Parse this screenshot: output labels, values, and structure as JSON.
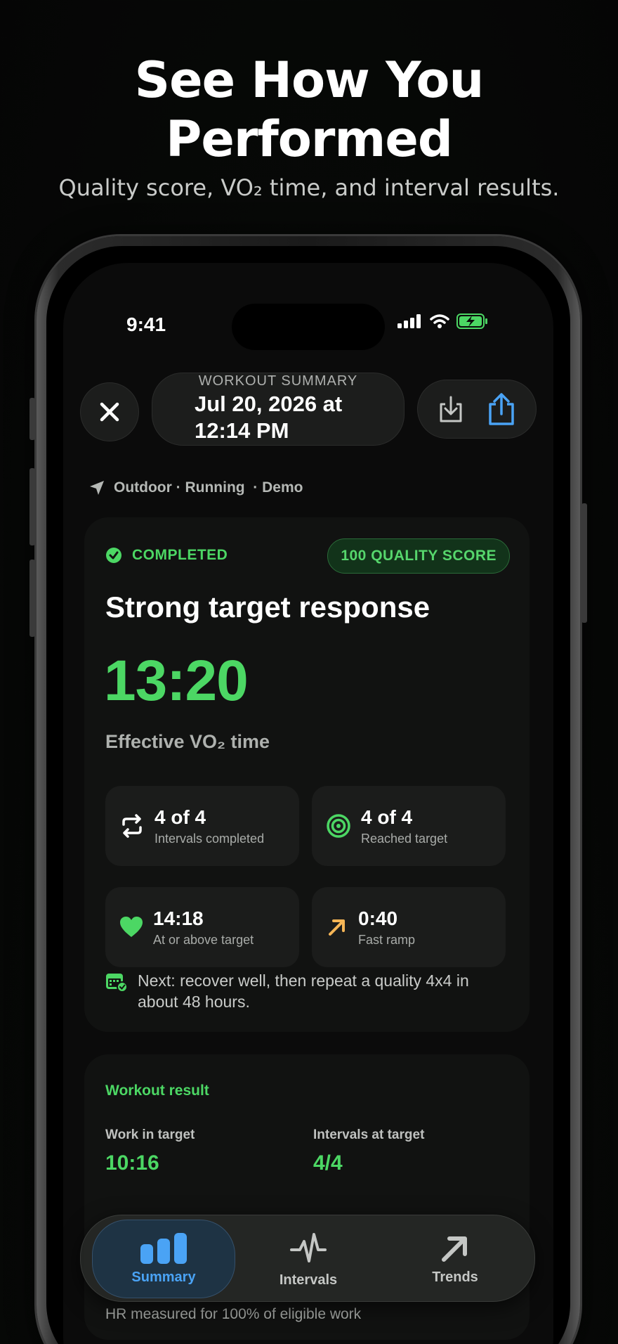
{
  "hero": {
    "title_line1": "See How You",
    "title_line2": "Performed",
    "subtitle": "Quality score, VO₂ time, and interval results."
  },
  "status_bar": {
    "time": "9:41"
  },
  "header": {
    "label": "WORKOUT SUMMARY",
    "date_line1": "Jul 20, 2026 at",
    "date_line2": "12:14 PM"
  },
  "meta": {
    "text": "Outdoor · Running  · Demo"
  },
  "summary": {
    "status": "COMPLETED",
    "quality_badge": "100 QUALITY SCORE",
    "headline": "Strong target response",
    "vo2_time": "13:20",
    "vo2_label": "Effective VO₂ time",
    "stats": [
      {
        "value": "4 of 4",
        "label": "Intervals completed",
        "icon": "repeat-icon"
      },
      {
        "value": "4 of 4",
        "label": "Reached target",
        "icon": "target-icon"
      },
      {
        "value": "14:18",
        "label": "At or above target",
        "icon": "heart-icon"
      },
      {
        "value": "0:40",
        "label": "Fast ramp",
        "icon": "arrow-up-right-icon"
      }
    ],
    "next": "Next: recover well, then repeat a quality 4x4 in about 48 hours."
  },
  "workout_result": {
    "title": "Workout result",
    "work_in_target_label": "Work in target",
    "work_in_target_value": "10:16",
    "intervals_at_target_label": "Intervals at target",
    "intervals_at_target_value": "4/4",
    "hr_note": "HR measured for 100% of eligible work"
  },
  "tabs": [
    {
      "label": "Summary",
      "icon": "bar-chart-icon",
      "active": true
    },
    {
      "label": "Intervals",
      "icon": "heartbeat-icon",
      "active": false
    },
    {
      "label": "Trends",
      "icon": "trend-arrow-icon",
      "active": false
    }
  ],
  "colors": {
    "accent_green": "#4cd764",
    "accent_blue": "#4aa3f5",
    "accent_orange": "#f5b556",
    "background": "#0b0b0b"
  }
}
